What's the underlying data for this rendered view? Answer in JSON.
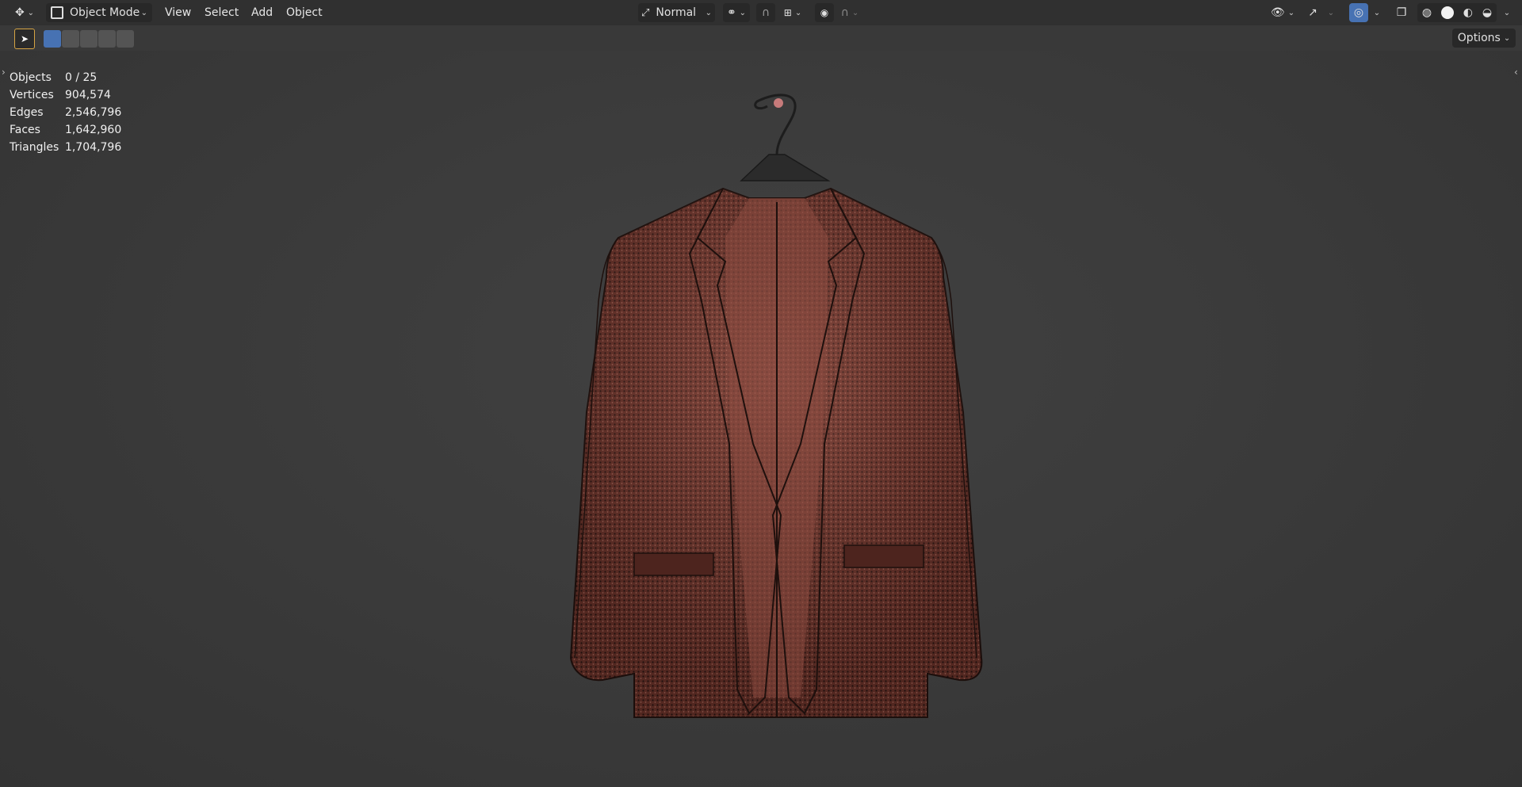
{
  "header": {
    "mode_label": "Object Mode",
    "menu": [
      "View",
      "Select",
      "Add",
      "Object"
    ],
    "transform_orientation": "Normal",
    "options_label": "Options"
  },
  "stats": {
    "rows": [
      {
        "label": "Objects",
        "value": "0 / 25"
      },
      {
        "label": "Vertices",
        "value": "904,574"
      },
      {
        "label": "Edges",
        "value": "2,546,796"
      },
      {
        "label": "Faces",
        "value": "1,642,960"
      },
      {
        "label": "Triangles",
        "value": "1,704,796"
      }
    ]
  },
  "icons": {
    "editor_type": "3d-viewport-icon",
    "mode": "object-mode-icon",
    "transform_orientation": "orientation-icon",
    "pivot": "pivot-point-icon",
    "snap": "magnet-icon",
    "snap_target": "snap-increment-icon",
    "proportional": "proportional-edit-icon",
    "falloff": "falloff-curve-icon",
    "visibility": "eye-icon",
    "gizmo": "gizmo-icon",
    "overlays": "overlay-icon",
    "xray": "xray-icon",
    "shading": [
      "wireframe-shading-icon",
      "solid-shading-icon",
      "material-shading-icon",
      "rendered-shading-icon"
    ],
    "tool": "select-box-tool-icon",
    "select_modes": [
      "select-new-icon",
      "select-extend-icon",
      "select-subtract-icon",
      "select-invert-icon",
      "select-intersect-icon"
    ]
  },
  "colors": {
    "accent": "#4772b3",
    "jacket": "#7a3a30",
    "jacket_light": "#a05a4e",
    "background": "#393939",
    "header": "#303030"
  }
}
